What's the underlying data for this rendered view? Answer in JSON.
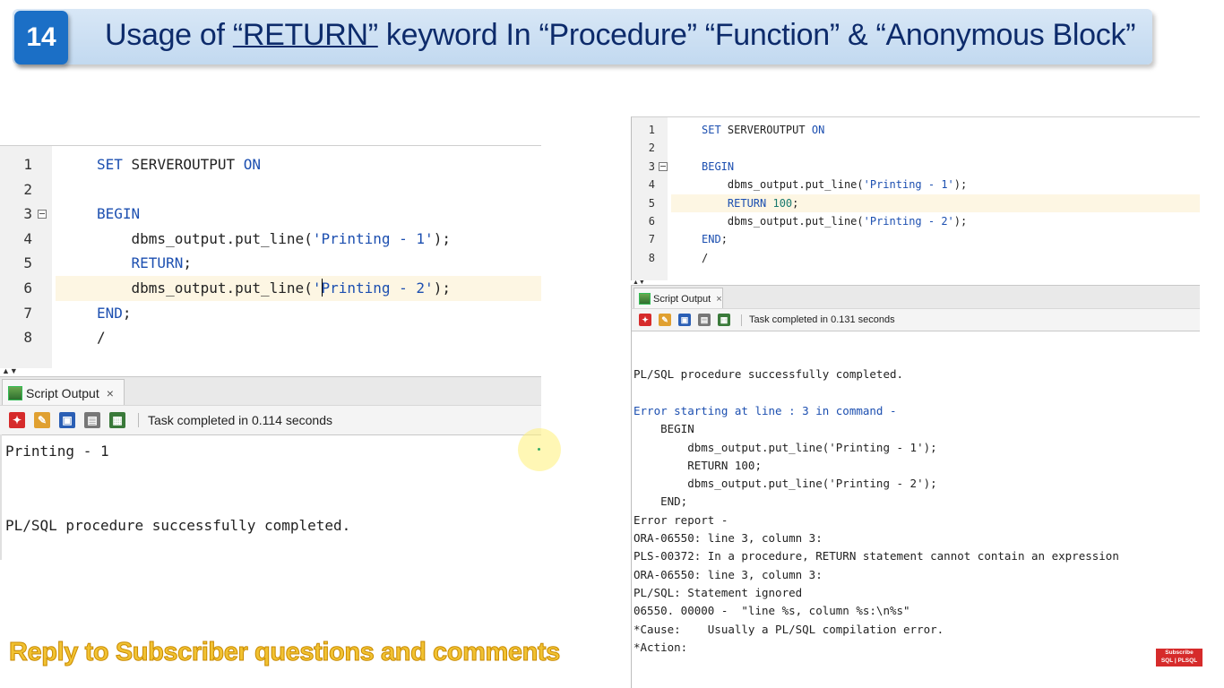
{
  "header": {
    "badge": "14",
    "title_prefix": "Usage of ",
    "title_keyword": "“RETURN”",
    "title_suffix": " keyword In “Procedure” “Function” & “Anonymous Block”"
  },
  "left_editor": {
    "lines": [
      {
        "n": "1",
        "parts": [
          [
            "k",
            "SET"
          ],
          [
            "p",
            " SERVEROUTPUT "
          ],
          [
            "k",
            "ON"
          ]
        ]
      },
      {
        "n": "2",
        "parts": []
      },
      {
        "n": "3",
        "parts": [
          [
            "k",
            "BEGIN"
          ]
        ]
      },
      {
        "n": "4",
        "parts": [
          [
            "p",
            "    dbms_output.put_line("
          ],
          [
            "s",
            "'Printing - 1'"
          ],
          [
            "p",
            ");"
          ]
        ]
      },
      {
        "n": "5",
        "parts": [
          [
            "k",
            "    RETURN"
          ],
          [
            "p",
            ";"
          ]
        ]
      },
      {
        "n": "6",
        "parts": [
          [
            "p",
            "    dbms_output.put_line("
          ],
          [
            "s",
            "'Printing - 2'"
          ],
          [
            "p",
            ");"
          ]
        ]
      },
      {
        "n": "7",
        "parts": [
          [
            "k",
            "END"
          ],
          [
            "p",
            ";"
          ]
        ]
      },
      {
        "n": "8",
        "parts": [
          [
            "p",
            "/"
          ]
        ]
      }
    ]
  },
  "left_output": {
    "tab_label": "Script Output",
    "close_glyph": "×",
    "status": "Task completed in 0.114 seconds",
    "lines": [
      "Printing - 1",
      "",
      "",
      "PL/SQL procedure successfully completed."
    ]
  },
  "right_editor": {
    "lines": [
      {
        "n": "1",
        "parts": [
          [
            "k",
            "SET"
          ],
          [
            "p",
            " SERVEROUTPUT "
          ],
          [
            "k",
            "ON"
          ]
        ]
      },
      {
        "n": "2",
        "parts": []
      },
      {
        "n": "3",
        "parts": [
          [
            "k",
            "BEGIN"
          ]
        ]
      },
      {
        "n": "4",
        "parts": [
          [
            "p",
            "    dbms_output.put_line("
          ],
          [
            "s",
            "'Printing - 1'"
          ],
          [
            "p",
            ");"
          ]
        ]
      },
      {
        "n": "5",
        "parts": [
          [
            "k",
            "    RETURN"
          ],
          [
            "p",
            " "
          ],
          [
            "d",
            "100"
          ],
          [
            "p",
            ";"
          ]
        ]
      },
      {
        "n": "6",
        "parts": [
          [
            "p",
            "    dbms_output.put_line("
          ],
          [
            "s",
            "'Printing - 2'"
          ],
          [
            "p",
            ");"
          ]
        ]
      },
      {
        "n": "7",
        "parts": [
          [
            "k",
            "END"
          ],
          [
            "p",
            ";"
          ]
        ]
      },
      {
        "n": "8",
        "parts": [
          [
            "p",
            "/"
          ]
        ]
      }
    ]
  },
  "right_output": {
    "tab_label": "Script Output",
    "close_glyph": "×",
    "status": "Task completed in 0.131 seconds",
    "lines": [
      {
        "t": "",
        "c": ""
      },
      {
        "t": "PL/SQL procedure successfully completed.",
        "c": ""
      },
      {
        "t": "",
        "c": ""
      },
      {
        "t": "Error starting at line : 3 in command -",
        "c": "err"
      },
      {
        "t": "    BEGIN",
        "c": ""
      },
      {
        "t": "        dbms_output.put_line('Printing - 1');",
        "c": ""
      },
      {
        "t": "        RETURN 100;",
        "c": ""
      },
      {
        "t": "        dbms_output.put_line('Printing - 2');",
        "c": ""
      },
      {
        "t": "    END;",
        "c": ""
      },
      {
        "t": "Error report -",
        "c": ""
      },
      {
        "t": "ORA-06550: line 3, column 3:",
        "c": ""
      },
      {
        "t": "PLS-00372: In a procedure, RETURN statement cannot contain an expression",
        "c": ""
      },
      {
        "t": "ORA-06550: line 3, column 3:",
        "c": ""
      },
      {
        "t": "PL/SQL: Statement ignored",
        "c": ""
      },
      {
        "t": "06550. 00000 -  \"line %s, column %s:\\n%s\"",
        "c": ""
      },
      {
        "t": "*Cause:    Usually a PL/SQL compilation error.",
        "c": ""
      },
      {
        "t": "*Action:",
        "c": ""
      }
    ]
  },
  "caption": "Reply to Subscriber questions and comments",
  "subscribe": {
    "line1": "Subscribe",
    "line2": "SQL | PLSQL"
  },
  "icons": [
    "pin-icon",
    "eraser-icon",
    "save-icon",
    "print-icon",
    "export-icon",
    "fold-minus-icon",
    "script-output-icon",
    "close-icon"
  ]
}
